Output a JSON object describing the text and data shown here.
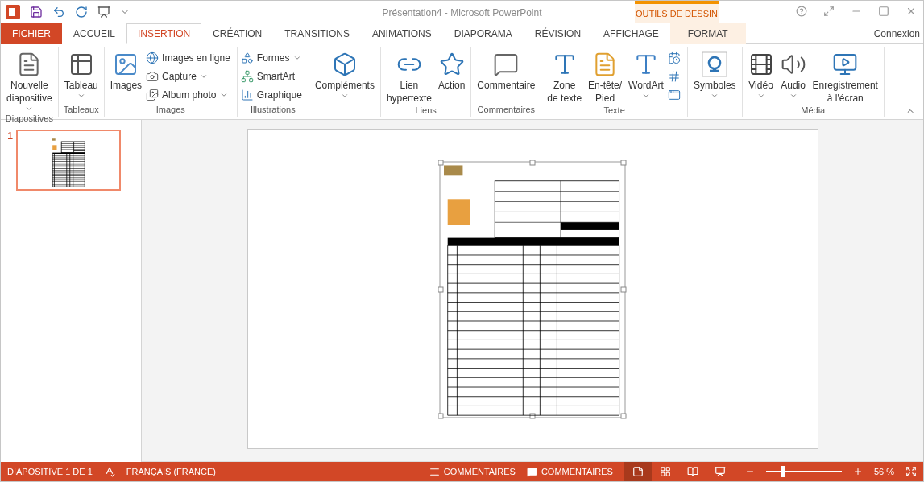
{
  "window": {
    "title": "Présentation4 - Microsoft PowerPoint",
    "contextual_group": "OUTILS DE DESSIN",
    "account": "Connexion"
  },
  "tabs": [
    {
      "label": "FICHIER",
      "kind": "file",
      "selected": false
    },
    {
      "label": "ACCUEIL",
      "kind": "tab",
      "selected": false
    },
    {
      "label": "INSERTION",
      "kind": "tab",
      "selected": true
    },
    {
      "label": "CRÉATION",
      "kind": "tab",
      "selected": false
    },
    {
      "label": "TRANSITIONS",
      "kind": "tab",
      "selected": false
    },
    {
      "label": "ANIMATIONS",
      "kind": "tab",
      "selected": false
    },
    {
      "label": "DIAPORAMA",
      "kind": "tab",
      "selected": false
    },
    {
      "label": "RÉVISION",
      "kind": "tab",
      "selected": false
    },
    {
      "label": "AFFICHAGE",
      "kind": "tab",
      "selected": false
    },
    {
      "label": "FORMAT",
      "kind": "contextual",
      "selected": false
    }
  ],
  "ribbon": [
    {
      "label": "Diapositives",
      "items": [
        {
          "kind": "large",
          "label": "Nouvelle\ndiapositive",
          "dropdown": true
        }
      ]
    },
    {
      "label": "Tableaux",
      "items": [
        {
          "kind": "large",
          "label": "Tableau",
          "dropdown": true
        }
      ]
    },
    {
      "label": "Images",
      "items": [
        {
          "kind": "large",
          "label": "Images",
          "dropdown": false
        },
        {
          "kind": "small",
          "label": "Images en ligne",
          "dropdown": false
        },
        {
          "kind": "small",
          "label": "Capture",
          "dropdown": true
        },
        {
          "kind": "small",
          "label": "Album photo",
          "dropdown": true
        }
      ]
    },
    {
      "label": "Illustrations",
      "items": [
        {
          "kind": "small",
          "label": "Formes",
          "dropdown": true
        },
        {
          "kind": "small",
          "label": "SmartArt",
          "dropdown": false
        },
        {
          "kind": "small",
          "label": "Graphique",
          "dropdown": false
        }
      ]
    },
    {
      "items": [
        {
          "kind": "large",
          "label": "Compléments",
          "dropdown": true
        }
      ]
    },
    {
      "label": "Liens",
      "items": [
        {
          "kind": "large",
          "label": "Lien\nhypertexte",
          "dropdown": false
        },
        {
          "kind": "large",
          "label": "Action",
          "dropdown": false
        }
      ]
    },
    {
      "label": "Commentaires",
      "items": [
        {
          "kind": "large",
          "label": "Commentaire",
          "dropdown": false
        }
      ]
    },
    {
      "label": "Texte",
      "items": [
        {
          "kind": "large",
          "label": "Zone\nde texte",
          "dropdown": false
        },
        {
          "kind": "large",
          "label": "En-tête/\nPied",
          "dropdown": false
        },
        {
          "kind": "large",
          "label": "WordArt",
          "dropdown": true
        },
        {
          "kind": "icon"
        },
        {
          "kind": "icon"
        },
        {
          "kind": "icon"
        }
      ]
    },
    {
      "items": [
        {
          "kind": "large",
          "label": "Symboles",
          "dropdown": true
        }
      ]
    },
    {
      "label": "Média",
      "items": [
        {
          "kind": "large",
          "label": "Vidéo",
          "dropdown": true
        },
        {
          "kind": "large",
          "label": "Audio",
          "dropdown": true
        },
        {
          "kind": "large",
          "label": "Enregistrement\nà l'écran",
          "dropdown": false
        }
      ]
    }
  ],
  "thumbnails": [
    {
      "number": "1",
      "selected": true
    }
  ],
  "status_bar": {
    "slide": "DIAPOSITIVE 1 DE 1",
    "language": "FRANÇAIS (FRANCE)",
    "notes": "COMMENTAIRES",
    "comments": "COMMENTAIRES",
    "views": [
      {
        "selected": true
      },
      {
        "selected": false
      },
      {
        "selected": false
      },
      {
        "selected": false
      }
    ],
    "zoom": {
      "level": 0.22,
      "reading": "56 %"
    }
  }
}
